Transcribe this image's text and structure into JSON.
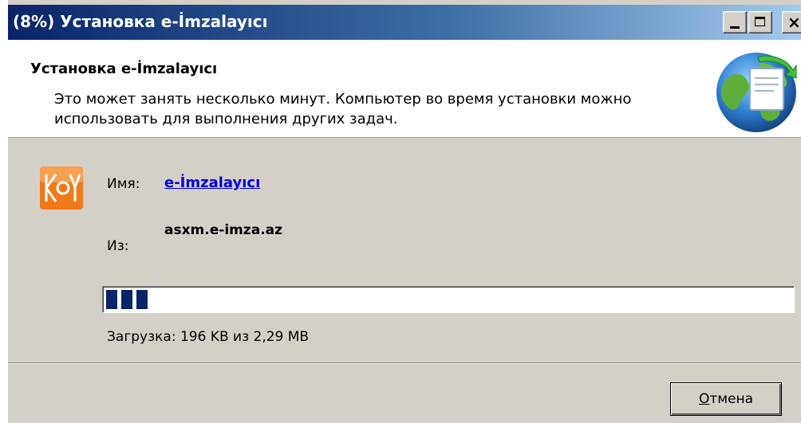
{
  "window": {
    "title": "(8%) Установка e-İmzalayıcı"
  },
  "header": {
    "title": "Установка e-İmzalayıcı",
    "description": "Это может занять несколько минут. Компьютер во время установки можно использовать для выполнения других задач.",
    "icon": "globe-install-icon"
  },
  "download": {
    "name_label": "Имя:",
    "name_value": "e-İmzalayıcı",
    "from_label": "Из:",
    "from_value": "asxm.e-imza.az",
    "app_icon": "key-app-icon",
    "progress_percent": 8,
    "status": "Загрузка: 196 KB из 2,29 MB"
  },
  "buttons": {
    "cancel_mnemonic": "О",
    "cancel_rest": "тмена"
  },
  "colors": {
    "title_start": "#0a246a",
    "title_end": "#a6caf0",
    "progress": "#0a246a",
    "link": "#0000e0",
    "face": "#d4d0c8"
  }
}
